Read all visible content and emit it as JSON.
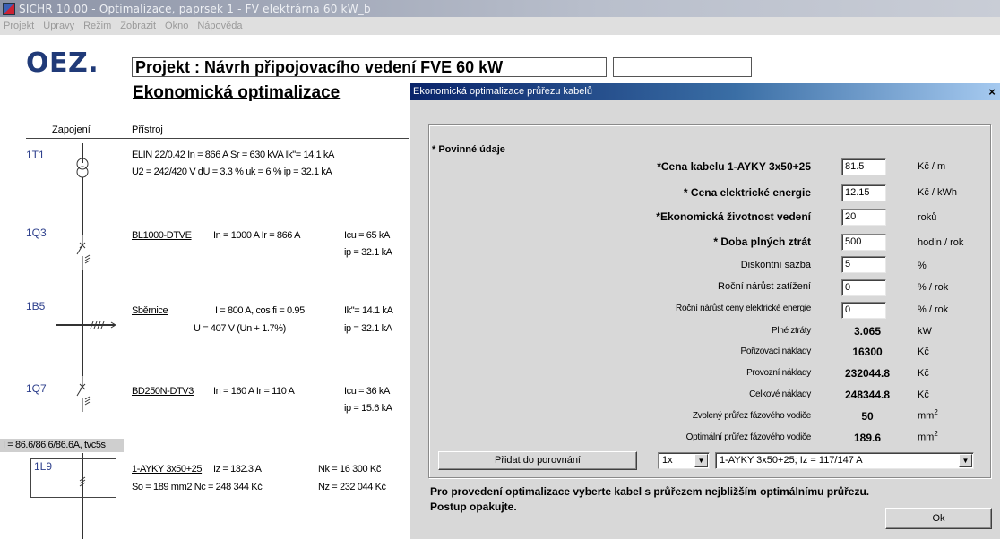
{
  "window": {
    "title": "SICHR 10.00 - Optimalizace, paprsek 1 - FV elektrárna 60 kW_b"
  },
  "menu": [
    "Projekt",
    "Úpravy",
    "Režim",
    "Zobrazit",
    "Okno",
    "Nápověda"
  ],
  "doc": {
    "logo": "OEZ",
    "project": "Projekt : Návrh připojovacího vedení FVE 60 kW",
    "subtitle": "Ekonomická optimalizace",
    "col_zapojeni": "Zapojení",
    "col_pristroj": "Přístroj",
    "rows": [
      {
        "ref": "1T1",
        "line1": "ELIN 22/0.42    In = 866 A    Sr = 630 kVA  Ik\"= 14.1 kA",
        "line2": "U2 = 242/420 V  dU = 3.3 %   uk = 6 %        ip = 32.1 kA"
      },
      {
        "ref": "1Q3",
        "name": "BL1000-DTVE",
        "line1": "In = 1000 A   Ir = 866 A",
        "line1b": "Icu = 65 kA",
        "line2": "ip = 32.1 kA"
      },
      {
        "ref": "1B5",
        "name": "Sběrnice",
        "line1": "I  = 800 A, cos fi = 0.95",
        "line1b": "Ik\"= 14.1 kA",
        "line2a": "U = 407 V (Un + 1.7%)",
        "line2": "ip = 32.1 kA"
      },
      {
        "ref": "1Q7",
        "name": "BD250N-DTV3",
        "line1": "In = 160 A   Ir = 110 A",
        "line1b": "Icu = 36 kA",
        "line2": "ip = 15.6 kA"
      }
    ],
    "current_bar": "I = 86.6/86.6/86.6A, tvc5s",
    "cable": {
      "ref": "1L9",
      "name": "1-AYKY 3x50+25",
      "line1": "Iz = 132.3 A",
      "line1b": "Nk = 16 300 Kč",
      "line2a": "So = 189 mm2   Nc = 248 344 Kč",
      "line2": "Nz = 232 044 Kč"
    }
  },
  "dialog": {
    "title": "Ekonomická optimalizace průřezu kabelů",
    "close": "×",
    "required_label": "* Povinné údaje",
    "inputs": [
      {
        "label": "*Cena kabelu 1-AYKY 3x50+25",
        "value": "81.5",
        "unit": "Kč / m"
      },
      {
        "label": "* Cena elektrické energie",
        "value": "12.15",
        "unit": "Kč / kWh"
      },
      {
        "label": "*Ekonomická životnost vedení",
        "value": "20",
        "unit": "roků"
      },
      {
        "label": "* Doba plných ztrát",
        "value": "500",
        "unit": "hodin / rok"
      },
      {
        "label": "Diskontní sazba",
        "value": "5",
        "unit": "%"
      },
      {
        "label": "Roční nárůst zatížení",
        "value": "0",
        "unit": "% / rok"
      },
      {
        "label": "Roční nárůst ceny elektrické energie",
        "value": "0",
        "unit": "% / rok"
      }
    ],
    "results": [
      {
        "label": "Plné ztráty",
        "value": "3.065",
        "unit": "kW"
      },
      {
        "label": "Pořizovací náklady",
        "value": "16300",
        "unit": "Kč"
      },
      {
        "label": "Provozní náklady",
        "value": "232044.8",
        "unit": "Kč"
      },
      {
        "label": "Celkové náklady",
        "value": "248344.8",
        "unit": "Kč"
      },
      {
        "label": "Zvolený průřez fázového vodiče",
        "value": "50",
        "unit": "mm"
      },
      {
        "label": "Optimální průřez fázového vodiče",
        "value": "189.6",
        "unit": "mm"
      }
    ],
    "unit_sup": "2",
    "add_button": "Přidat do porovnání",
    "count_select": "1x",
    "cable_select": "1-AYKY 3x50+25; Iz = 117/147 A",
    "note1": "Pro provedení optimalizace vyberte kabel s průřezem nejbližším optimálnímu průřezu.",
    "note2": "Postup opakujte.",
    "ok_button": "Ok"
  }
}
